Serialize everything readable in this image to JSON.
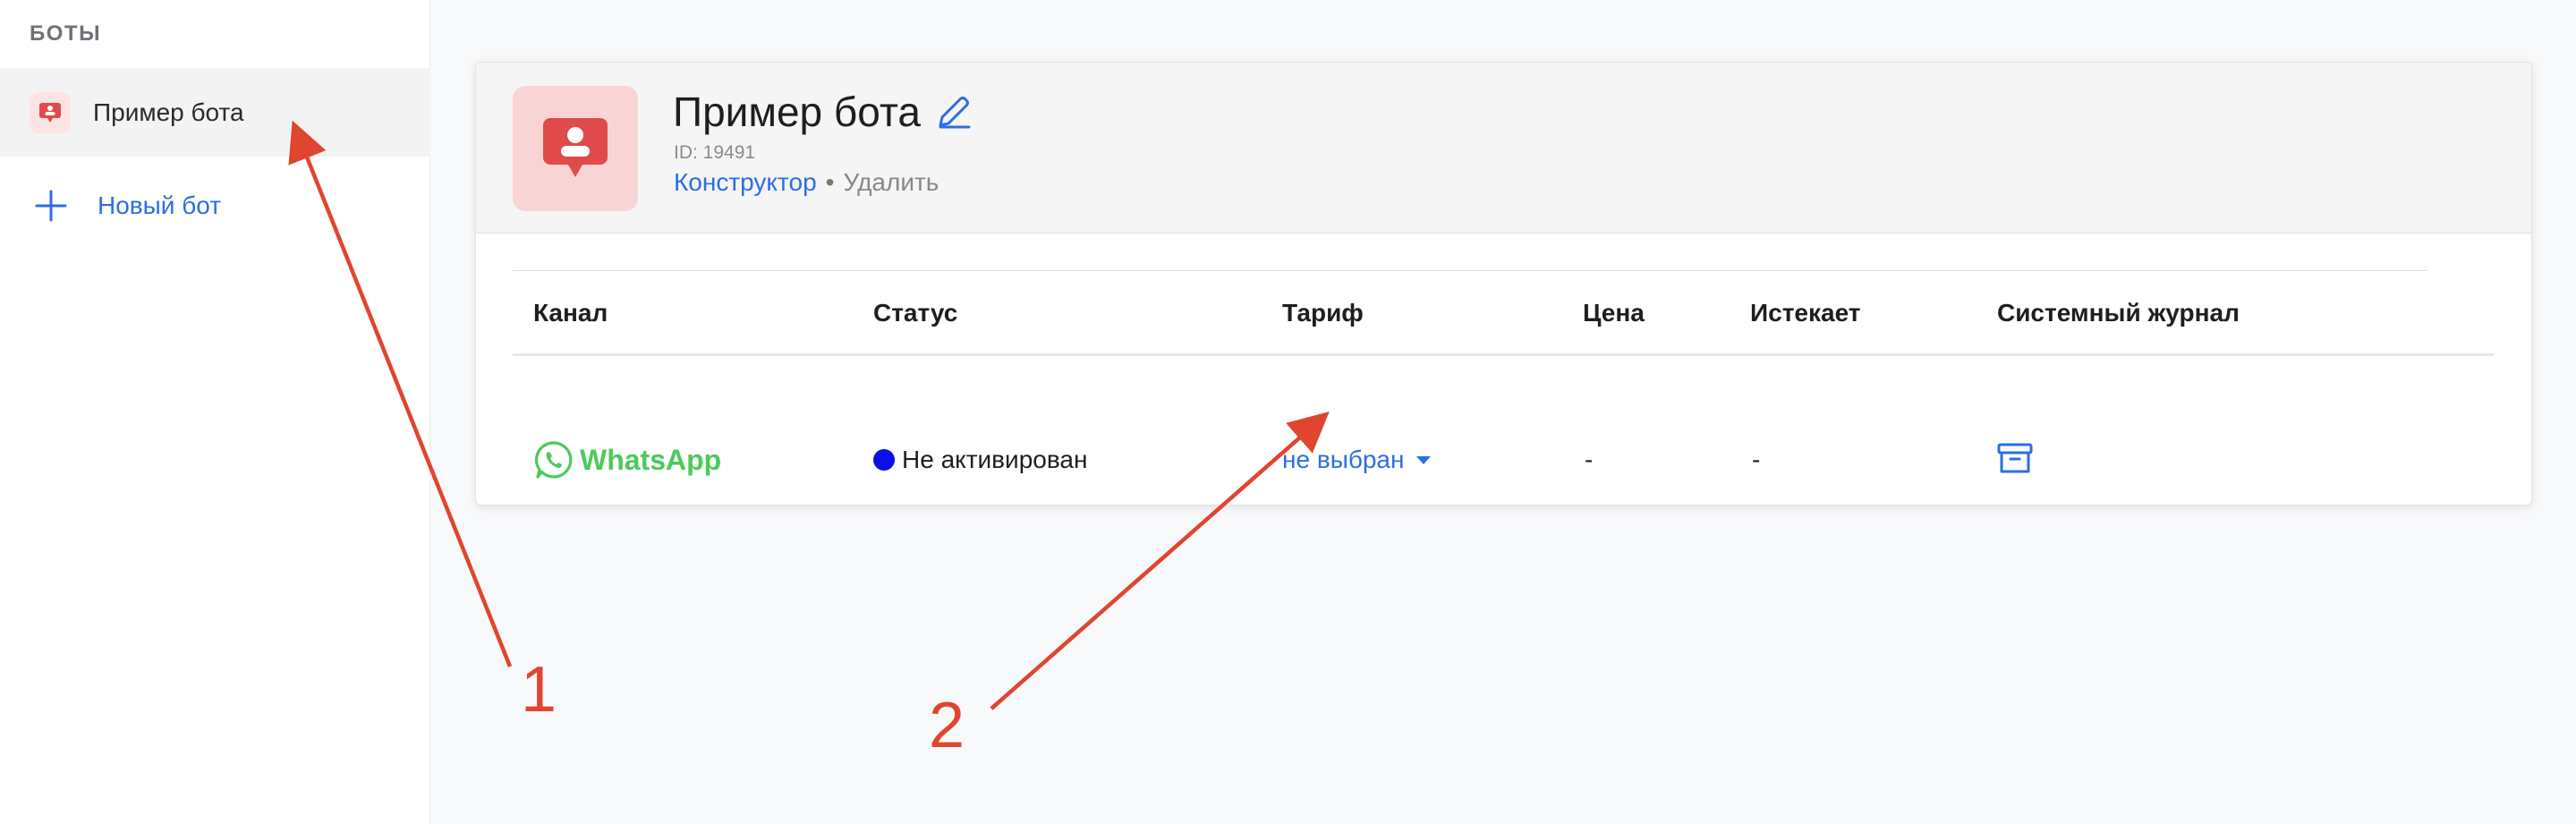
{
  "sidebar": {
    "header": "БОТЫ",
    "items": [
      {
        "label": "Пример бота",
        "icon": "bot-message-icon"
      }
    ],
    "new_bot_label": "Новый бот"
  },
  "bot": {
    "title": "Пример бота",
    "id_text": "ID: 19491",
    "links": {
      "constructor": "Конструктор",
      "separator": "•",
      "delete": "Удалить"
    }
  },
  "table": {
    "headers": {
      "channel": "Канал",
      "status": "Статус",
      "tariff": "Тариф",
      "price": "Цена",
      "expires": "Истекает",
      "log": "Системный журнал"
    },
    "rows": [
      {
        "channel": "WhatsApp",
        "status": "Не активирован",
        "tariff": "не выбран",
        "price": "-",
        "expires": "-"
      }
    ]
  },
  "annotations": {
    "one": "1",
    "two": "2"
  },
  "colors": {
    "accent": "#2b6fe0",
    "whatsapp": "#4cca5a",
    "status_dot": "#0a10e6",
    "annotation": "#e0452f",
    "bot_icon_bg": "#f8d4d4",
    "bot_icon_fg": "#e04a4a"
  }
}
